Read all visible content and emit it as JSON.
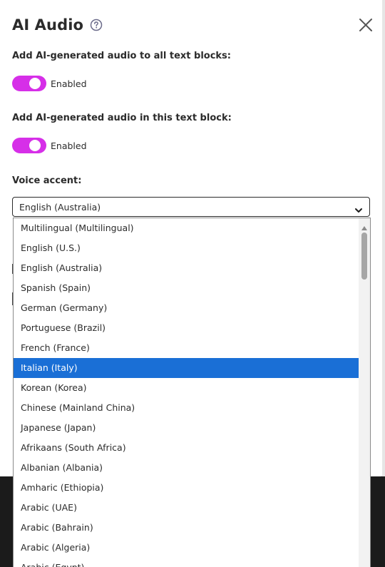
{
  "dialog": {
    "title": "AI Audio",
    "help_icon": "question-circle-icon",
    "close_icon": "close-x-icon"
  },
  "settings": {
    "all_blocks": {
      "label": "Add AI-generated audio to all text blocks:",
      "state": "Enabled",
      "on": true
    },
    "this_block": {
      "label": "Add AI-generated audio in this text block:",
      "state": "Enabled",
      "on": true
    }
  },
  "voice_accent": {
    "label": "Voice accent:",
    "selected_value": "English (Australia)",
    "chevron_icon": "chevron-down-icon",
    "highlighted_option": "Italian (Italy)",
    "options": [
      "Multilingual (Multilingual)",
      "English (U.S.)",
      "English (Australia)",
      "Spanish (Spain)",
      "German (Germany)",
      "Portuguese (Brazil)",
      "French (France)",
      "Italian (Italy)",
      "Korean (Korea)",
      "Chinese (Mainland China)",
      "Japanese (Japan)",
      "Afrikaans (South Africa)",
      "Albanian (Albania)",
      "Amharic (Ethiopia)",
      "Arabic (UAE)",
      "Arabic (Bahrain)",
      "Arabic (Algeria)",
      "Arabic (Egypt)"
    ]
  },
  "colors": {
    "toggle_on": "#d62fe8",
    "selected_option": "#1a6fd6",
    "backdrop": "#1b1b1b"
  }
}
